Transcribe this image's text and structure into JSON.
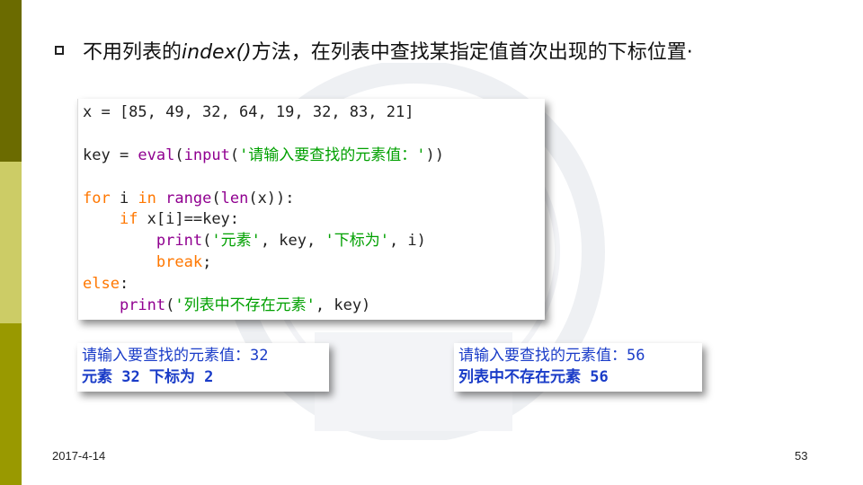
{
  "slide": {
    "title_prefix": "不用列表的",
    "title_method": "index()",
    "title_suffix": "方法，在列表中查找某指定值首次出现的下标位置·",
    "date": "2017-4-14",
    "page_number": "53"
  },
  "code": {
    "l1": "x = [85, 49, 32, 64, 19, 32, 83, 21]",
    "l2_a": "key = ",
    "l2_eval": "eval",
    "l2_b": "(",
    "l2_input": "input",
    "l2_c": "(",
    "l2_str": "'请输入要查找的元素值：'",
    "l2_d": "))",
    "l3_for": "for",
    "l3_a": " i ",
    "l3_in": "in",
    "l3_b": " ",
    "l3_range": "range",
    "l3_c": "(",
    "l3_len": "len",
    "l3_d": "(x)):",
    "l4_indent": "    ",
    "l4_if": "if",
    "l4_a": " x[i]==key:",
    "l5_indent": "        ",
    "l5_print": "print",
    "l5_a": "(",
    "l5_s1": "'元素'",
    "l5_b": ", key, ",
    "l5_s2": "'下标为'",
    "l5_c": ", i)",
    "l6_indent": "        ",
    "l6_break": "break",
    "l6_a": ";",
    "l7_else": "else",
    "l7_a": ":",
    "l8_indent": "    ",
    "l8_print": "print",
    "l8_a": "(",
    "l8_str": "'列表中不存在元素'",
    "l8_b": ", key)"
  },
  "output1": {
    "line1_prompt": "请输入要查找的元素值：",
    "line1_value": "32",
    "line2": "元素 32 下标为 2"
  },
  "output2": {
    "line1_prompt": "请输入要查找的元素值：",
    "line1_value": "56",
    "line2": "列表中不存在元素 56"
  },
  "colors": {
    "keyword": "#ff7700",
    "builtin": "#900090",
    "string": "#00a000",
    "output": "#1a3cc8"
  }
}
